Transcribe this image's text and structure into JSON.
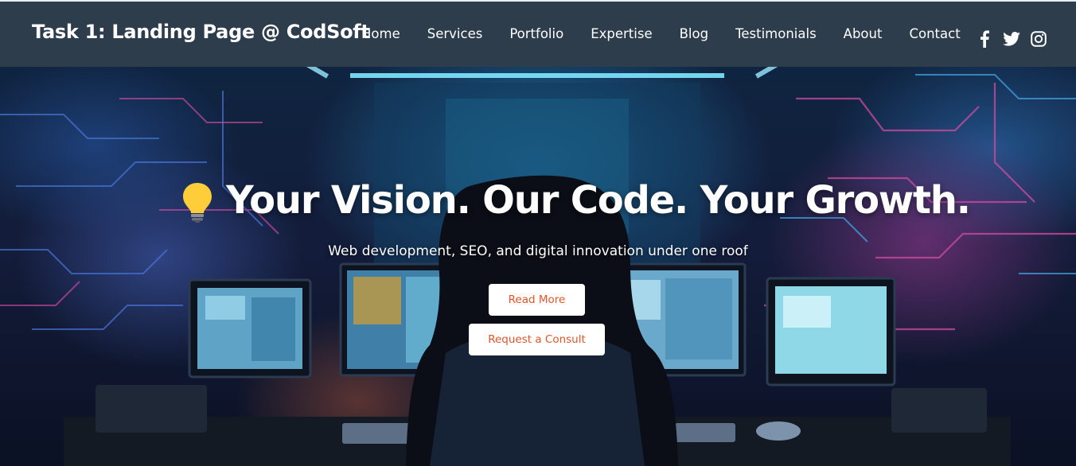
{
  "navbar": {
    "brand": "Task 1: Landing Page @ CodSoft",
    "links": [
      "Home",
      "Services",
      "Portfolio",
      "Expertise",
      "Blog",
      "Testimonials",
      "About",
      "Contact"
    ],
    "social_icons": [
      "facebook-icon",
      "twitter-icon",
      "instagram-icon"
    ],
    "background_color": "#2d3d4c"
  },
  "hero": {
    "headline": "Your Vision. Our Code. Your Growth.",
    "headline_icon": "lightbulb-icon",
    "subheadline": "Web development, SEO, and digital innovation under one roof",
    "buttons": {
      "read_more": "Read More",
      "consult": "Request a Consult"
    },
    "button_text_color": "#e2542a"
  }
}
